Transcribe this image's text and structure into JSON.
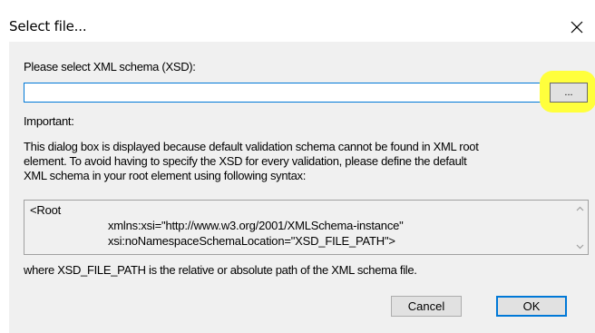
{
  "window": {
    "title": "Select file..."
  },
  "form": {
    "schema_label": "Please select XML schema (XSD):",
    "path_value": "",
    "browse_label": "...",
    "important_label": "Important:",
    "info_lines": [
      "This dialog box is displayed because default validation schema cannot be found in XML root",
      "element. To avoid having to specify the XSD for every validation, please define the default",
      "XML schema in your root element using following syntax:"
    ],
    "code_lines": [
      "<Root",
      "xmlns:xsi=\"http://www.w3.org/2001/XMLSchema-instance\"",
      "xsi:noNamespaceSchemaLocation=\"XSD_FILE_PATH\">"
    ],
    "footer_note": "where XSD_FILE_PATH is the relative or absolute path of the XML schema file."
  },
  "buttons": {
    "cancel": "Cancel",
    "ok": "OK"
  },
  "colors": {
    "client_bg": "#f0f0f0",
    "focus_border": "#0078d7",
    "highlight": "#ffff3c"
  }
}
